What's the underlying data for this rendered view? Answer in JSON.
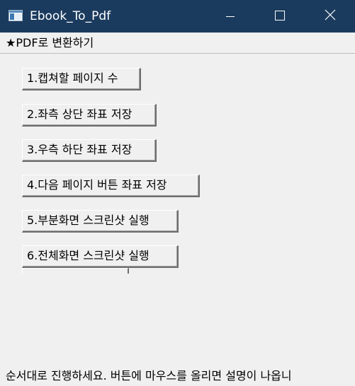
{
  "window": {
    "title": "Ebook_To_Pdf",
    "icon": "app-window-icon",
    "controls": {
      "minimize": "minimize-icon",
      "maximize": "maximize-icon",
      "close": "close-icon"
    },
    "titlebar_color": "#1b3b5e"
  },
  "menu": {
    "items": [
      {
        "label": "★PDF로 변환하기"
      }
    ]
  },
  "buttons": [
    {
      "label": "1.캡쳐할 페이지 수"
    },
    {
      "label": "2.좌측 상단 좌표 저장"
    },
    {
      "label": "3.우측 하단 좌표 저장"
    },
    {
      "label": "4.다음 페이지 버튼 좌표 저장"
    },
    {
      "label": "5.부분화면 스크린샷 실행"
    },
    {
      "label": "6.전체화면 스크린샷 실행"
    }
  ],
  "status": {
    "text": "순서대로 진행하세요. 버튼에 마우스를 올리면 설명이 나옵니"
  }
}
